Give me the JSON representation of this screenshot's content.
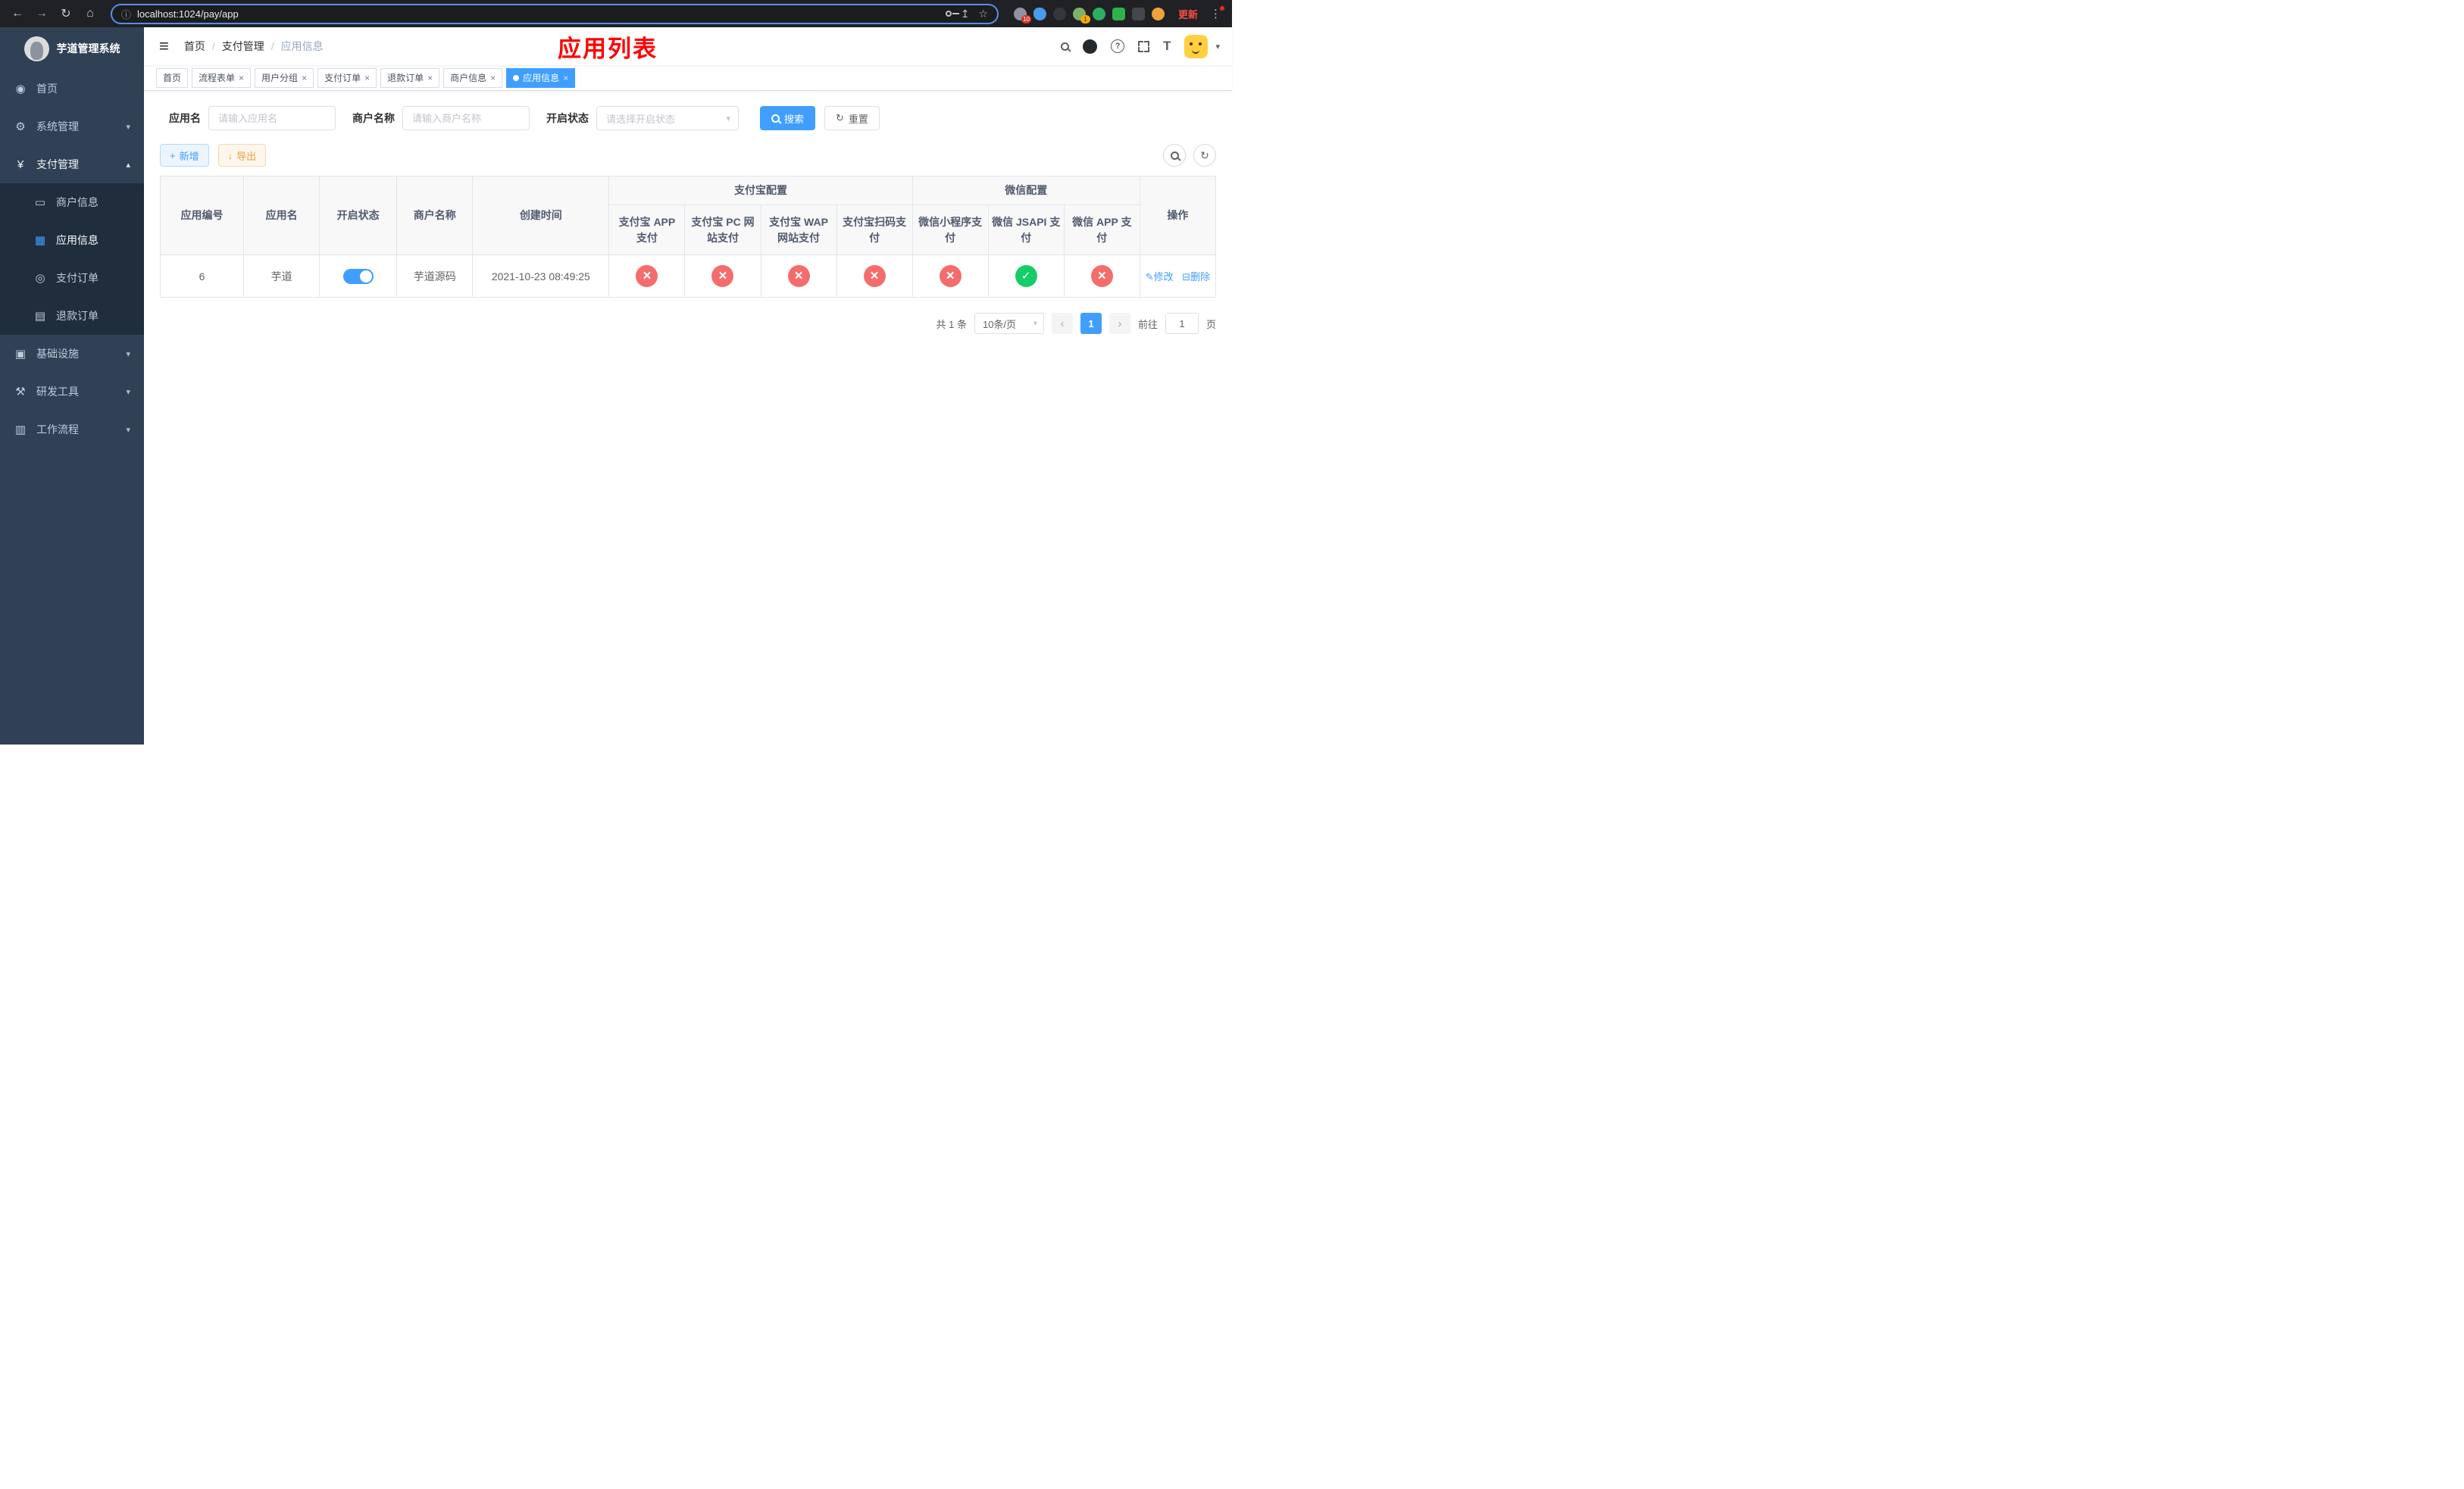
{
  "colors": {
    "accent": "#409eff",
    "danger": "#f56c6c",
    "success": "#13ce66",
    "warning": "#e6a23c",
    "sidebar": "#304156",
    "submenu": "#1f2d3d",
    "title-red": "#ff0000"
  },
  "icons": {
    "back": "←",
    "forward": "→",
    "reload": "↻",
    "home": "⌂",
    "info": "ⓘ",
    "share": "↥",
    "star": "☆",
    "more": "⋮",
    "hamburger": "≡",
    "question": "?",
    "font_size": "T",
    "caret_down": "▾",
    "dashboard": "◉",
    "gear": "⚙",
    "yen": "¥",
    "card": "▭",
    "grid": "▦",
    "order": "◎",
    "refund": "▤",
    "infra": "▣",
    "tools": "⚒",
    "workflow": "▥",
    "chev_down": "▾",
    "chev_up": "▴",
    "plus": "+",
    "download": "↓",
    "refresh": "↻",
    "edit": "✎",
    "trash": "⊟",
    "close": "×",
    "prev": "‹",
    "next": "›"
  },
  "browser": {
    "url": "localhost:1024/pay/app",
    "update_label": "更新",
    "ext_badge_large": "10",
    "ext_badge_small": "1"
  },
  "sidebar": {
    "app_title": "芋道管理系统",
    "items": {
      "home": "首页",
      "system": "系统管理",
      "payment": "支付管理",
      "merchant": "商户信息",
      "app": "应用信息",
      "order": "支付订单",
      "refund": "退款订单",
      "infra": "基础设施",
      "tools": "研发工具",
      "workflow": "工作流程"
    }
  },
  "header": {
    "breadcrumb": [
      "首页",
      "支付管理",
      "应用信息"
    ],
    "page_title": "应用列表"
  },
  "tabs": [
    {
      "label": "首页",
      "closable": false,
      "active": false
    },
    {
      "label": "流程表单",
      "closable": true,
      "active": false
    },
    {
      "label": "用户分组",
      "closable": true,
      "active": false
    },
    {
      "label": "支付订单",
      "closable": true,
      "active": false
    },
    {
      "label": "退款订单",
      "closable": true,
      "active": false
    },
    {
      "label": "商户信息",
      "closable": true,
      "active": false
    },
    {
      "label": "应用信息",
      "closable": true,
      "active": true
    }
  ],
  "filters": {
    "app_name_label": "应用名",
    "app_name_placeholder": "请输入应用名",
    "merchant_label": "商户名称",
    "merchant_placeholder": "请输入商户名称",
    "status_label": "开启状态",
    "status_placeholder": "请选择开启状态",
    "search_label": "搜索",
    "reset_label": "重置"
  },
  "toolbar": {
    "add_label": "新增",
    "export_label": "导出"
  },
  "table": {
    "columns": [
      "应用编号",
      "应用名",
      "开启状态",
      "商户名称",
      "创建时间"
    ],
    "groups": [
      {
        "label": "支付宝配置",
        "columns": [
          "支付宝 APP 支付",
          "支付宝 PC 网站支付",
          "支付宝 WAP 网站支付",
          "支付宝扫码支付"
        ]
      },
      {
        "label": "微信配置",
        "columns": [
          "微信小程序支付",
          "微信 JSAPI 支付",
          "微信 APP 支付"
        ]
      }
    ],
    "action_column": "操作",
    "rows": [
      {
        "id": "6",
        "name": "芋道",
        "enabled": true,
        "merchant": "芋道源码",
        "created": "2021-10-23 08:49:25",
        "statuses": [
          "no",
          "no",
          "no",
          "no",
          "no",
          "yes",
          "no"
        ],
        "edit_label": "修改",
        "delete_label": "删除"
      }
    ]
  },
  "pagination": {
    "total": "共 1 条",
    "page_size": "10条/页",
    "page": "1",
    "goto_prefix": "前往",
    "goto_value": "1",
    "goto_suffix": "页"
  }
}
